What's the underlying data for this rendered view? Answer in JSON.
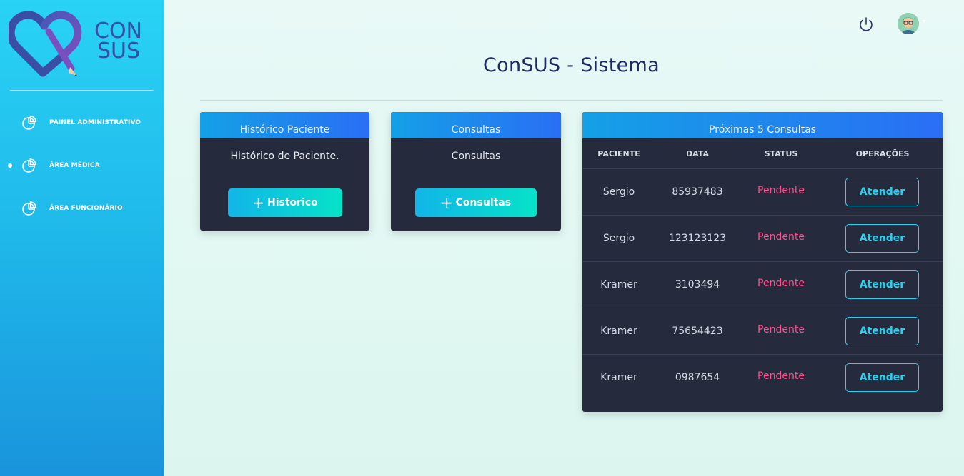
{
  "app": {
    "title": "ConSUS - Sistema",
    "logo_text_line1": "CON",
    "logo_text_line2": "SUS"
  },
  "sidebar": {
    "items": [
      {
        "label": "PAINEL ADMINISTRATIVO",
        "icon": "pie-chart-icon",
        "active": false
      },
      {
        "label": "ÁREA MÉDICA",
        "icon": "pie-chart-icon",
        "active": true
      },
      {
        "label": "ÁREA FUNCIONÁRIO",
        "icon": "pie-chart-icon",
        "active": false
      }
    ]
  },
  "topbar": {
    "power_icon": "power-icon",
    "avatar": "user-avatar"
  },
  "cards": {
    "historico": {
      "header": "Histórico Paciente",
      "text": "Histórico de Paciente.",
      "button": "Historico"
    },
    "consultas": {
      "header": "Consultas",
      "text": "Consultas",
      "button": "Consultas"
    }
  },
  "proximas": {
    "header": "Próximas 5 Consultas",
    "columns": [
      "PACIENTE",
      "DATA",
      "STATUS",
      "OPERAÇÕES"
    ],
    "rows": [
      {
        "paciente": "Sergio",
        "data": "85937483",
        "status": "Pendente",
        "action": "Atender"
      },
      {
        "paciente": "Sergio",
        "data": "123123123",
        "status": "Pendente",
        "action": "Atender"
      },
      {
        "paciente": "Kramer",
        "data": "3103494",
        "status": "Pendente",
        "action": "Atender"
      },
      {
        "paciente": "Kramer",
        "data": "75654423",
        "status": "Pendente",
        "action": "Atender"
      },
      {
        "paciente": "Kramer",
        "data": "0987654",
        "status": "Pendente",
        "action": "Atender"
      }
    ]
  },
  "colors": {
    "sidebar_top": "#29d3f5",
    "sidebar_bottom": "#1a94dc",
    "card_bg": "#262a3d",
    "status_pending": "#ff4d8d",
    "accent": "#27d3f0"
  }
}
